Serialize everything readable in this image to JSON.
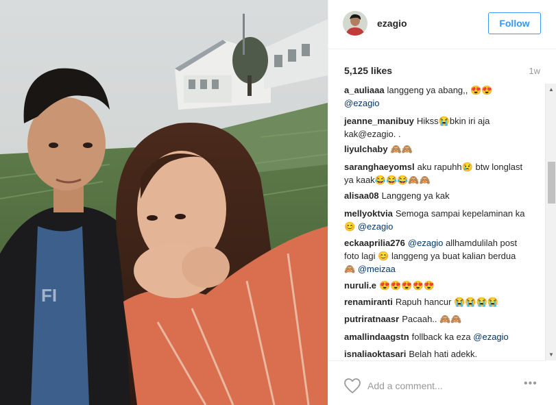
{
  "post": {
    "username": "ezagio",
    "follow_label": "Follow",
    "likes": "5,125 likes",
    "age": "1w"
  },
  "comments": [
    {
      "user": "a_auliaaa",
      "text": "langgeng ya abang,, 😍😍",
      "mention": "@ezagio"
    },
    {
      "user": "jeanne_manibuy",
      "text": "Hikss😭bkin iri aja kak@ezagio. .",
      "mention": ""
    },
    {
      "user": "liyulchaby",
      "text": "🙈🙈",
      "mention": ""
    },
    {
      "user": "saranghaeyomsl",
      "text": "aku rapuhh😢 btw longlast ya kaak😂😂😂🙈🙈",
      "mention": ""
    },
    {
      "user": "alisaa08",
      "text": "Langgeng ya kak",
      "mention": ""
    },
    {
      "user": "mellyoktvia",
      "text": "Semoga sampai kepelaminan ka 😊",
      "mention": "@ezagio"
    },
    {
      "user": "eckaaprilia276",
      "text": "",
      "mention": "@ezagio",
      "text2": "allhamdulilah post foto lagi 😊 langgeng ya buat kalian berdua 🙈",
      "mention2": "@meizaa"
    },
    {
      "user": "nuruli.e",
      "text": "😍😍😍😍😍",
      "mention": ""
    },
    {
      "user": "renamiranti",
      "text": "Rapuh hancur 😭😭😭😭",
      "mention": ""
    },
    {
      "user": "putriratnaasr",
      "text": "Pacaah.. 🙈🙈",
      "mention": ""
    },
    {
      "user": "amallindaagstn",
      "text": "follback ka eza",
      "mention": "@ezagio"
    },
    {
      "user": "isnaliaoktasari",
      "text": "Belah hati adekk.",
      "mention": ""
    }
  ],
  "composer": {
    "placeholder": "Add a comment...",
    "more_label": "•••"
  },
  "icons": {
    "heart": "heart-outline-icon",
    "more": "more-options-icon",
    "scroll_up": "scroll-up-arrow-icon",
    "scroll_down": "scroll-down-arrow-icon"
  },
  "colors": {
    "accent": "#3897f0",
    "mention": "#003569",
    "muted": "#999999"
  }
}
